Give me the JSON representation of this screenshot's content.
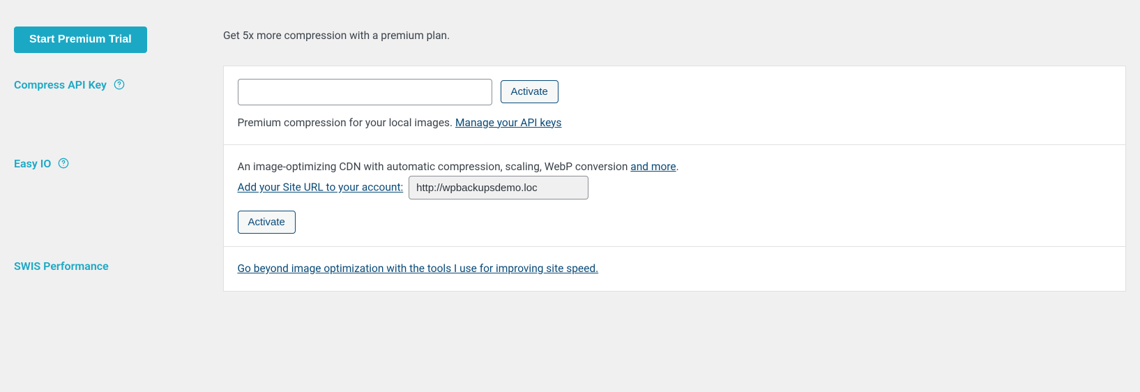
{
  "premiumTrial": {
    "buttonLabel": "Start Premium Trial",
    "description": "Get 5x more compression with a premium plan."
  },
  "compressApiKey": {
    "label": "Compress API Key",
    "activateLabel": "Activate",
    "descriptionPrefix": "Premium compression for your local images. ",
    "manageLink": "Manage your API keys"
  },
  "easyIO": {
    "label": "Easy IO",
    "descriptionPrefix": "An image-optimizing CDN with automatic compression, scaling, WebP conversion ",
    "andMoreLink": "and more",
    "descriptionSuffix": ".",
    "addSiteUrlLink": "Add your Site URL to your account:",
    "siteUrl": "http://wpbackupsdemo.loc",
    "activateLabel": "Activate"
  },
  "swisPerformance": {
    "label": "SWIS Performance",
    "link": "Go beyond image optimization with the tools I use for improving site speed."
  }
}
